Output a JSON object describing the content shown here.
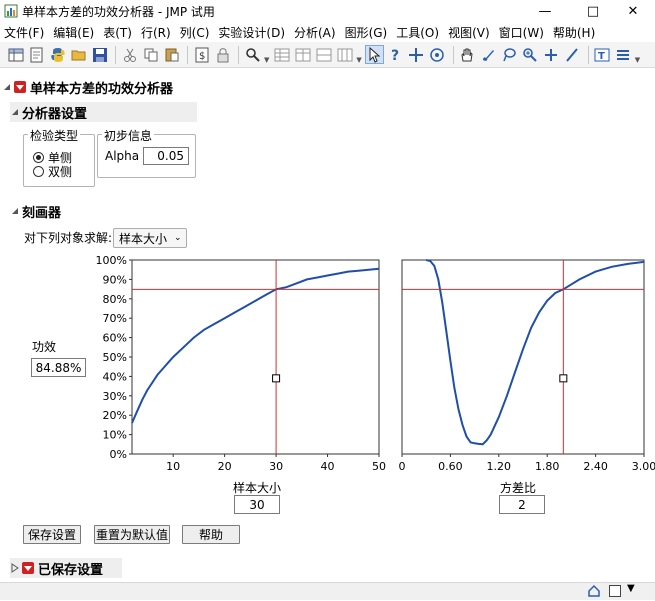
{
  "window": {
    "title": "单样本方差的功效分析器 - JMP 试用",
    "minimize": "—",
    "maximize": "□",
    "close": "✕"
  },
  "menu": [
    "文件(F)",
    "编辑(E)",
    "表(T)",
    "行(R)",
    "列(C)",
    "实验设计(D)",
    "分析(A)",
    "图形(G)",
    "工具(O)",
    "视图(V)",
    "窗口(W)",
    "帮助(H)"
  ],
  "report": {
    "title": "单样本方差的功效分析器",
    "settings": {
      "title": "分析器设置",
      "test_type": {
        "label": "检验类型",
        "options": [
          "单侧",
          "双侧"
        ],
        "selected": "单侧"
      },
      "initial_info": {
        "label": "初步信息",
        "alpha_label": "Alpha",
        "alpha_value": "0.05"
      }
    },
    "profiler": {
      "title": "刻画器",
      "solve_for_label": "对下列对象求解:",
      "solve_for_value": "样本大小",
      "response_label": "功效",
      "response_value": "84.88%",
      "factors": [
        {
          "name": "样本大小",
          "value": "30"
        },
        {
          "name": "方差比",
          "value": "2"
        }
      ]
    },
    "buttons": {
      "save": "保存设置",
      "reset": "重置为默认值",
      "help": "帮助"
    },
    "saved": {
      "title": "已保存设置"
    }
  },
  "chart_data": [
    {
      "type": "line",
      "xlabel": "样本大小",
      "ylabel": "功效",
      "xlim": [
        2,
        50
      ],
      "ylim": [
        0,
        100
      ],
      "x_ticks": [
        "10",
        "20",
        "30",
        "40",
        "50"
      ],
      "y_ticks": [
        "0%",
        "10%",
        "20%",
        "30%",
        "40%",
        "50%",
        "60%",
        "70%",
        "80%",
        "90%",
        "100%"
      ],
      "current_x": 30,
      "current_y": 84.88,
      "series": [
        {
          "x": [
            2,
            3,
            4,
            5,
            6,
            7,
            8,
            9,
            10,
            12,
            14,
            16,
            18,
            20,
            22,
            24,
            26,
            28,
            30,
            32,
            34,
            36,
            38,
            40,
            42,
            44,
            46,
            48,
            50
          ],
          "values": [
            16,
            22,
            28,
            33,
            37,
            41,
            44,
            47,
            50,
            55,
            60,
            64,
            67,
            70,
            73,
            76,
            79,
            82,
            84.88,
            86,
            88,
            90,
            91,
            92,
            93,
            94,
            94.5,
            95,
            95.5
          ]
        }
      ]
    },
    {
      "type": "line",
      "xlabel": "方差比",
      "ylabel": "功效",
      "xlim": [
        0,
        3
      ],
      "ylim": [
        0,
        100
      ],
      "x_ticks": [
        "0",
        "0.60",
        "1.20",
        "1.80",
        "2.40",
        "3.00"
      ],
      "current_x": 2,
      "current_y": 84.88,
      "series": [
        {
          "x": [
            0.3,
            0.35,
            0.4,
            0.45,
            0.5,
            0.55,
            0.6,
            0.65,
            0.7,
            0.75,
            0.8,
            0.85,
            0.9,
            0.95,
            1.0,
            1.05,
            1.1,
            1.2,
            1.3,
            1.4,
            1.5,
            1.6,
            1.7,
            1.8,
            1.9,
            2.0,
            2.2,
            2.4,
            2.6,
            2.8,
            3.0
          ],
          "values": [
            100,
            99.5,
            97,
            90,
            78,
            63,
            48,
            34,
            23,
            15,
            9,
            6,
            5.5,
            5.2,
            5,
            7,
            10,
            19,
            30,
            42,
            54,
            65,
            73,
            79,
            83,
            84.88,
            90,
            94,
            96.5,
            98,
            99
          ]
        }
      ]
    }
  ],
  "colors": {
    "curve": "#1f4fa8",
    "crosshair": "#c83232",
    "accent_red": "#d02020"
  }
}
